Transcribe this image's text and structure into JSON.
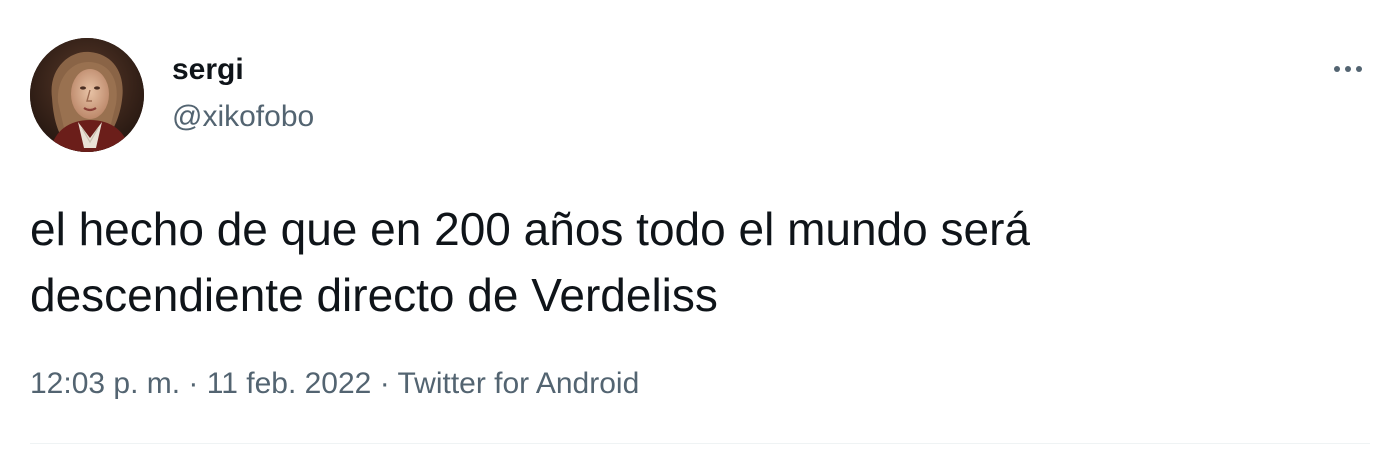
{
  "user": {
    "display_name": "sergi",
    "handle": "@xikofobo",
    "avatar_icon": "portrait-avatar-icon"
  },
  "tweet": {
    "text": "el hecho de que en 200 años todo el mundo será\ndescendiente directo de Verdeliss"
  },
  "meta": {
    "time": "12:03 p. m.",
    "separator_1": " · ",
    "date": "11 feb. 2022",
    "separator_2": " · ",
    "source": "Twitter for Android"
  },
  "actions": {
    "more_icon": "more-horizontal-icon"
  },
  "colors": {
    "text_primary": "#0f1419",
    "text_secondary": "#536471",
    "divider": "#eff3f4",
    "background": "#ffffff"
  }
}
